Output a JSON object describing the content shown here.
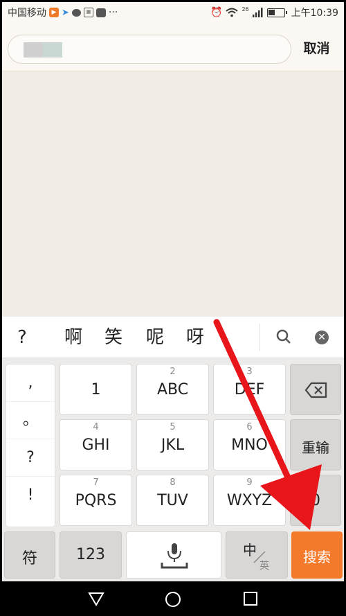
{
  "statusbar": {
    "carrier": "中国移动",
    "more": "···",
    "network": "26",
    "time": "上午10:39"
  },
  "search": {
    "cancel_label": "取消"
  },
  "candidates": {
    "items": [
      "?",
      "啊",
      "笑",
      "呢",
      "呀"
    ]
  },
  "keyboard": {
    "punct": [
      ",",
      "。",
      "?",
      "!"
    ],
    "keys": {
      "k1": {
        "num": "",
        "label": "1"
      },
      "k2": {
        "num": "2",
        "label": "ABC"
      },
      "k3": {
        "num": "3",
        "label": "DEF"
      },
      "k4": {
        "num": "4",
        "label": "GHI"
      },
      "k5": {
        "num": "5",
        "label": "JKL"
      },
      "k6": {
        "num": "6",
        "label": "MNO"
      },
      "k7": {
        "num": "7",
        "label": "PQRS"
      },
      "k8": {
        "num": "8",
        "label": "TUV"
      },
      "k9": {
        "num": "9",
        "label": "WXYZ"
      },
      "k0": {
        "label": "0"
      }
    },
    "reenter_label": "重输",
    "symbols_label": "符",
    "numbers_label": "123",
    "lang_zh": "中",
    "lang_en": "英",
    "search_label": "搜索"
  },
  "colors": {
    "accent": "#f5792a",
    "arrow": "#e8151b"
  }
}
